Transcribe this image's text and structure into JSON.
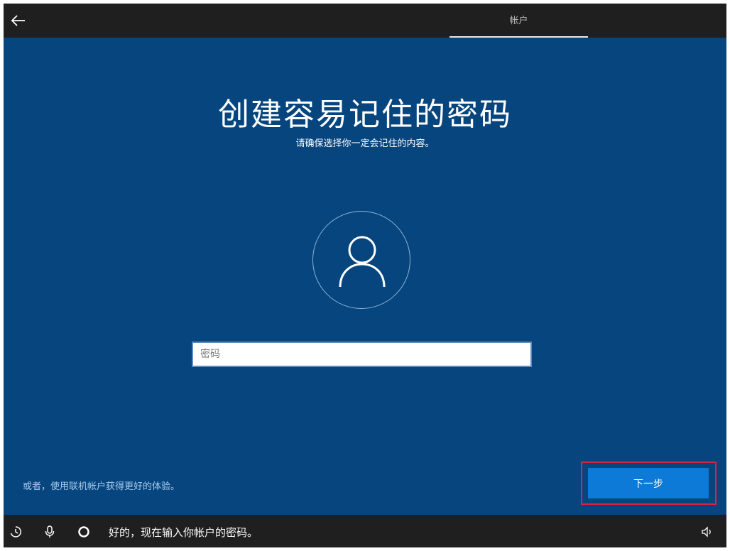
{
  "header": {
    "back_icon": "arrow-left-icon",
    "tab_label": "帐户"
  },
  "main": {
    "title": "创建容易记住的密码",
    "subtitle": "请确保选择你一定会记住的内容。",
    "avatar_icon": "user-icon",
    "password": {
      "value": "",
      "placeholder": "密码"
    },
    "online_account_link": "或者，使用联机帐户获得更好的体验。",
    "next_button": "下一步",
    "colors": {
      "background": "#06457e",
      "button": "#0c7ad6",
      "highlight": "#d7263d",
      "link": "#a9cdf0"
    }
  },
  "footer": {
    "icons": [
      "accessibility-icon",
      "microphone-icon",
      "cortana-icon",
      "volume-icon"
    ],
    "cortana_text": "好的，现在输入你帐户的密码。"
  }
}
